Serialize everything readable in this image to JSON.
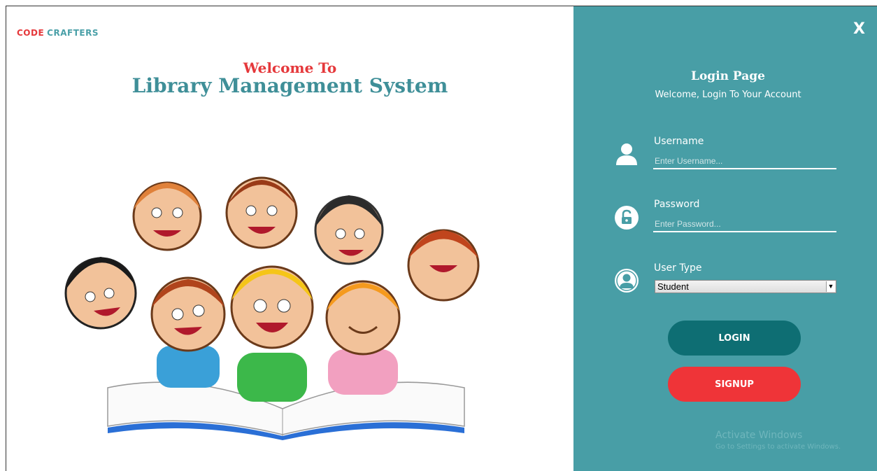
{
  "brand": {
    "part1": "CODE",
    "part2": "CRAFTERS"
  },
  "hero": {
    "welcome": "Welcome To",
    "title": "Library Management System"
  },
  "login": {
    "close": "X",
    "title": "Login Page",
    "subtitle": "Welcome, Login To Your Account",
    "username_label": "Username",
    "username_placeholder": "Enter Username...",
    "password_label": "Password",
    "password_placeholder": "Enter Password...",
    "usertype_label": "User Type",
    "usertype_value": "Student",
    "login_button": "LOGIN",
    "signup_button": "SIGNUP"
  },
  "watermark": {
    "line1": "Activate Windows",
    "line2": "Go to Settings to activate Windows."
  },
  "colors": {
    "panel": "#489ea6",
    "brand_red": "#e5383b",
    "teal_text": "#3f8f98",
    "login_btn": "#0e6e73",
    "signup_btn": "#ef3438"
  },
  "icons": {
    "username": "user-icon",
    "password": "lock-icon",
    "usertype": "user-circle-icon",
    "illustration": "children-reading-book"
  }
}
